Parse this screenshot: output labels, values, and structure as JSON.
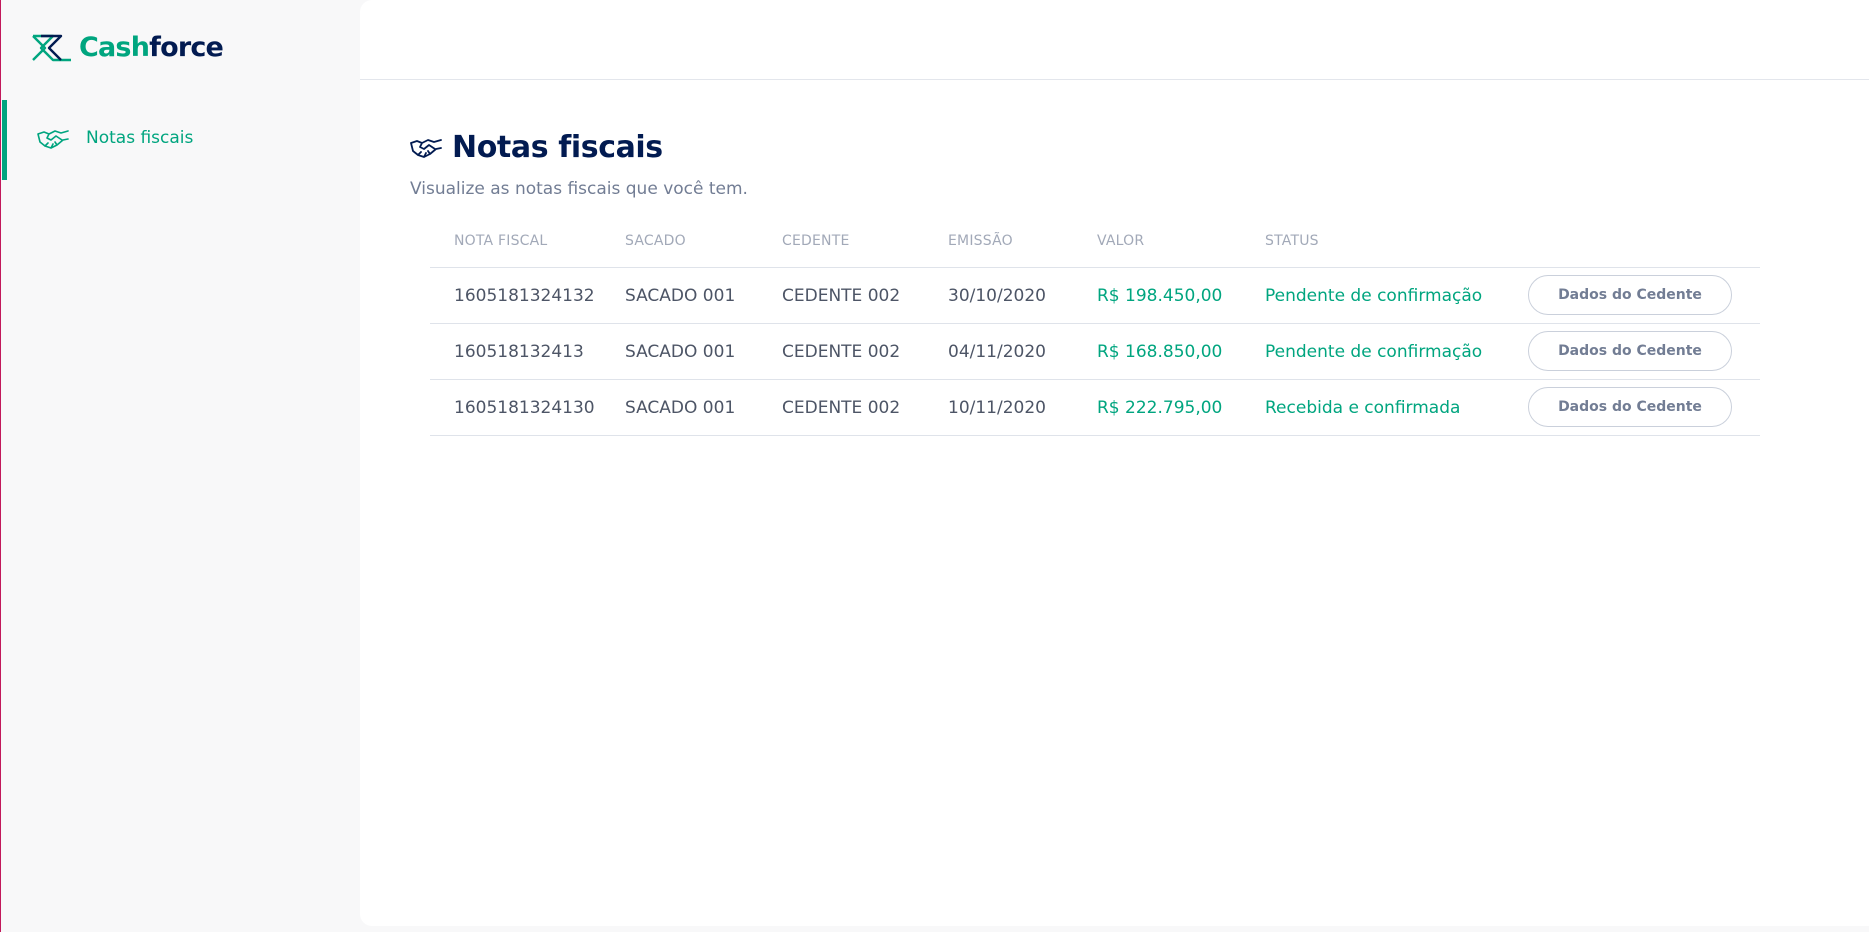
{
  "brand": {
    "name_part1": "Cash",
    "name_part2": "force",
    "colors": {
      "primary": "#00a57f",
      "dark": "#021b51",
      "muted": "#727d94"
    }
  },
  "sidebar": {
    "items": [
      {
        "label": "Notas fiscais",
        "icon": "handshake-icon",
        "active": true
      }
    ]
  },
  "page": {
    "title": "Notas fiscais",
    "subtitle": "Visualize as notas fiscais que você tem."
  },
  "table": {
    "columns": [
      "NOTA FISCAL",
      "SACADO",
      "CEDENTE",
      "EMISSÃO",
      "VALOR",
      "STATUS"
    ],
    "rows": [
      {
        "nota": "1605181324132",
        "sacado": "SACADO 001",
        "cedente": "CEDENTE 002",
        "emissao": "30/10/2020",
        "valor": "R$ 198.450,00",
        "status": "Pendente de confirmação",
        "action": "Dados do Cedente"
      },
      {
        "nota": "160518132413",
        "sacado": "SACADO 001",
        "cedente": "CEDENTE 002",
        "emissao": "04/11/2020",
        "valor": "R$ 168.850,00",
        "status": "Pendente de confirmação",
        "action": "Dados do Cedente"
      },
      {
        "nota": "1605181324130",
        "sacado": "SACADO 001",
        "cedente": "CEDENTE 002",
        "emissao": "10/11/2020",
        "valor": "R$ 222.795,00",
        "status": "Recebida e confirmada",
        "action": "Dados do Cedente"
      }
    ]
  }
}
